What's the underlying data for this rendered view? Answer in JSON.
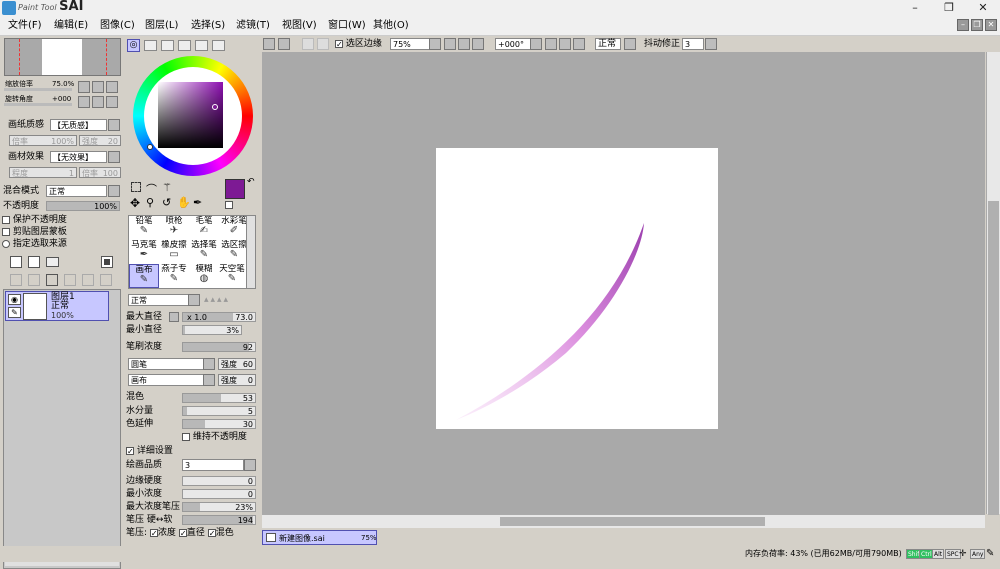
{
  "app": {
    "title_small": "Paint Tool",
    "title_big": "SAI"
  },
  "window": {
    "min": "–",
    "max": "❐",
    "close": "✕"
  },
  "menus": [
    "文件(F)",
    "编辑(E)",
    "图像(C)",
    "图层(L)",
    "选择(S)",
    "滤镜(T)",
    "视图(V)",
    "窗口(W)",
    "其他(O)"
  ],
  "navigator": {
    "zoom_label": "缩放倍率",
    "zoom_value": "75.0%",
    "angle_label": "旋转角度",
    "angle_value": "+000"
  },
  "paper": {
    "texture_label": "画纸质感",
    "texture_value": "【无质感】",
    "scale_label": "倍率",
    "scale_value": "100%",
    "strength_label": "强度",
    "strength_value": "20",
    "effect_label": "画材效果",
    "effect_value": "【无效果】",
    "degree_label": "程度",
    "degree_value": "1",
    "degree_scale_label": "倍率",
    "degree_scale_value": "100"
  },
  "layer_props": {
    "blend_label": "混合模式",
    "blend_value": "正常",
    "opacity_label": "不透明度",
    "opacity_value": "100%",
    "opacity_level": 1.0,
    "protect_opacity": "保护不透明度",
    "clipping": "剪贴图层蒙板",
    "selection_source": "指定选取来源"
  },
  "layer": {
    "name": "图层1",
    "mode": "正常",
    "opacity": "100%"
  },
  "colors": {
    "primary": "#7d1a94",
    "secondary": "#ffffff",
    "accent": "#5050b0",
    "selected_bg": "#c7c7ff"
  },
  "toolbar": {
    "selection_edge": "选区边缘",
    "zoom": "75%",
    "angle": "+000°",
    "blend_mode": "正常",
    "stabilizer_label": "抖动修正",
    "stabilizer_value": "3"
  },
  "tools": [
    [
      "铅笔",
      "喷枪",
      "毛笔",
      "水彩笔"
    ],
    [
      "马克笔",
      "橡皮擦",
      "选择笔",
      "选区擦"
    ],
    [
      "画布",
      "燕子专",
      "模糊",
      "天空笔"
    ]
  ],
  "tools_icons": [
    [
      "✎",
      "✈",
      "✍",
      "✐"
    ],
    [
      "✒",
      "▭",
      "✎",
      "✎"
    ],
    [
      "✎",
      "✎",
      "◍",
      "✎"
    ]
  ],
  "brush": {
    "mode": "正常",
    "max_size_label": "最大直径",
    "max_size_mult": "x 1.0",
    "max_size_value": "73.0",
    "min_size_label": "最小直径",
    "min_size_value": "3%",
    "min_size_level": 0.03,
    "density_label": "笔刷浓度",
    "density_value": "92",
    "density_level": 0.92,
    "shape_value": "圆笔",
    "shape_strength_label": "强度",
    "shape_strength_value": "60",
    "texture_value": "画布",
    "texture_strength_label": "强度",
    "texture_strength_value": "0",
    "blend_label": "混色",
    "blend_value": "53",
    "blend_level": 0.53,
    "water_label": "水分量",
    "water_value": "5",
    "water_level": 0.05,
    "persistence_label": "色延伸",
    "persistence_value": "30",
    "persistence_level": 0.3,
    "keep_opacity": "维持不透明度",
    "advanced": "详细设置",
    "quality_label": "绘画品质",
    "quality_value": "3",
    "edge_label": "边缘硬度",
    "edge_value": "0",
    "min_density_label": "最小浓度",
    "min_density_value": "0",
    "max_pressure_label": "最大浓度笔压",
    "max_pressure_value": "23%",
    "max_pressure_level": 0.23,
    "hardness_label": "笔压 硬↔软",
    "hardness_value": "194",
    "hardness_level": 0.97,
    "pressure_label": "笔压:",
    "pressure_density": "浓度",
    "pressure_size": "直径",
    "pressure_blend": "混色"
  },
  "tab": {
    "filename": "新建图像.sai",
    "zoom": "75%"
  },
  "status": {
    "memory": "内存负荷率: 43% (已用62MB/可用790MB)",
    "keys": [
      "Shift",
      "Ctrl",
      "Alt",
      "SPC",
      "Any"
    ]
  }
}
